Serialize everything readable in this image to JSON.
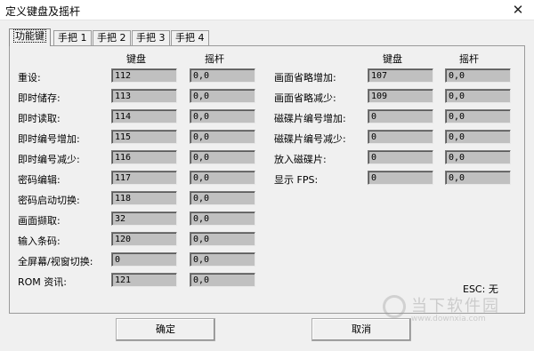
{
  "window": {
    "title": "定义键盘及摇杆",
    "close_glyph": "✕"
  },
  "tabs": [
    "功能键",
    "手把 1",
    "手把 2",
    "手把 3",
    "手把 4"
  ],
  "headers": {
    "keyboard": "键盘",
    "joystick": "摇杆"
  },
  "left_rows": [
    {
      "label": "重设:",
      "key": "112",
      "joy": "0,0"
    },
    {
      "label": "即时储存:",
      "key": "113",
      "joy": "0,0"
    },
    {
      "label": "即时读取:",
      "key": "114",
      "joy": "0,0"
    },
    {
      "label": "即时编号增加:",
      "key": "115",
      "joy": "0,0"
    },
    {
      "label": "即时编号减少:",
      "key": "116",
      "joy": "0,0"
    },
    {
      "label": "密码编辑:",
      "key": "117",
      "joy": "0,0"
    },
    {
      "label": "密码启动切换:",
      "key": "118",
      "joy": "0,0"
    },
    {
      "label": "画面撷取:",
      "key": "32",
      "joy": "0,0"
    },
    {
      "label": "输入条码:",
      "key": "120",
      "joy": "0,0"
    },
    {
      "label": "全屏幕/视窗切换:",
      "key": "0",
      "joy": "0,0"
    },
    {
      "label": "ROM 资讯:",
      "key": "121",
      "joy": "0,0"
    }
  ],
  "right_rows": [
    {
      "label": "画面省略增加:",
      "key": "107",
      "joy": "0,0"
    },
    {
      "label": "画面省略减少:",
      "key": "109",
      "joy": "0,0"
    },
    {
      "label": "磁碟片编号增加:",
      "key": "0",
      "joy": "0,0"
    },
    {
      "label": "磁碟片编号减少:",
      "key": "0",
      "joy": "0,0"
    },
    {
      "label": "放入磁碟片:",
      "key": "0",
      "joy": "0,0"
    },
    {
      "label": "显示 FPS:",
      "key": "0",
      "joy": "0,0"
    }
  ],
  "esc_text": "ESC: 无",
  "buttons": {
    "ok": "确定",
    "cancel": "取消"
  },
  "watermark": {
    "text": "当下软件园",
    "url": "www.downxia.com"
  }
}
